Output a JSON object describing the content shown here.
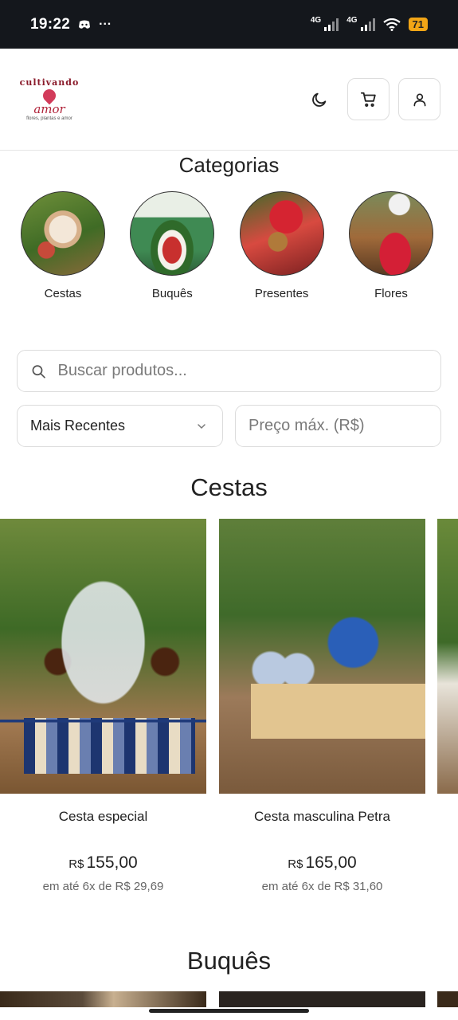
{
  "status_bar": {
    "time": "19:22",
    "net1": "4G",
    "net2": "4G",
    "battery": "71"
  },
  "header": {
    "logo_line1": "cultivando",
    "logo_line2": "amor",
    "logo_tagline": "flores, plantas e amor",
    "icons": [
      "moon-icon",
      "cart-icon",
      "user-icon"
    ]
  },
  "categories": {
    "title": "Categorias",
    "items": [
      {
        "label": "Cestas"
      },
      {
        "label": "Buquês"
      },
      {
        "label": "Presentes"
      },
      {
        "label": "Flores"
      }
    ]
  },
  "filters": {
    "search_placeholder": "Buscar produtos...",
    "sort_selected": "Mais Recentes",
    "price_placeholder": "Preço máx. (R$)"
  },
  "sections": [
    {
      "title": "Cestas",
      "products": [
        {
          "name": "Cesta especial",
          "currency": "R$",
          "price": "155,00",
          "installments": "em até 6x de R$ 29,69"
        },
        {
          "name": "Cesta masculina Petra",
          "currency": "R$",
          "price": "165,00",
          "installments": "em até 6x de R$ 31,60"
        }
      ]
    },
    {
      "title": "Buquês"
    }
  ],
  "colors": {
    "accent": "#1f3a7a",
    "statusbar": "#14171c",
    "battery": "#f2a516"
  }
}
